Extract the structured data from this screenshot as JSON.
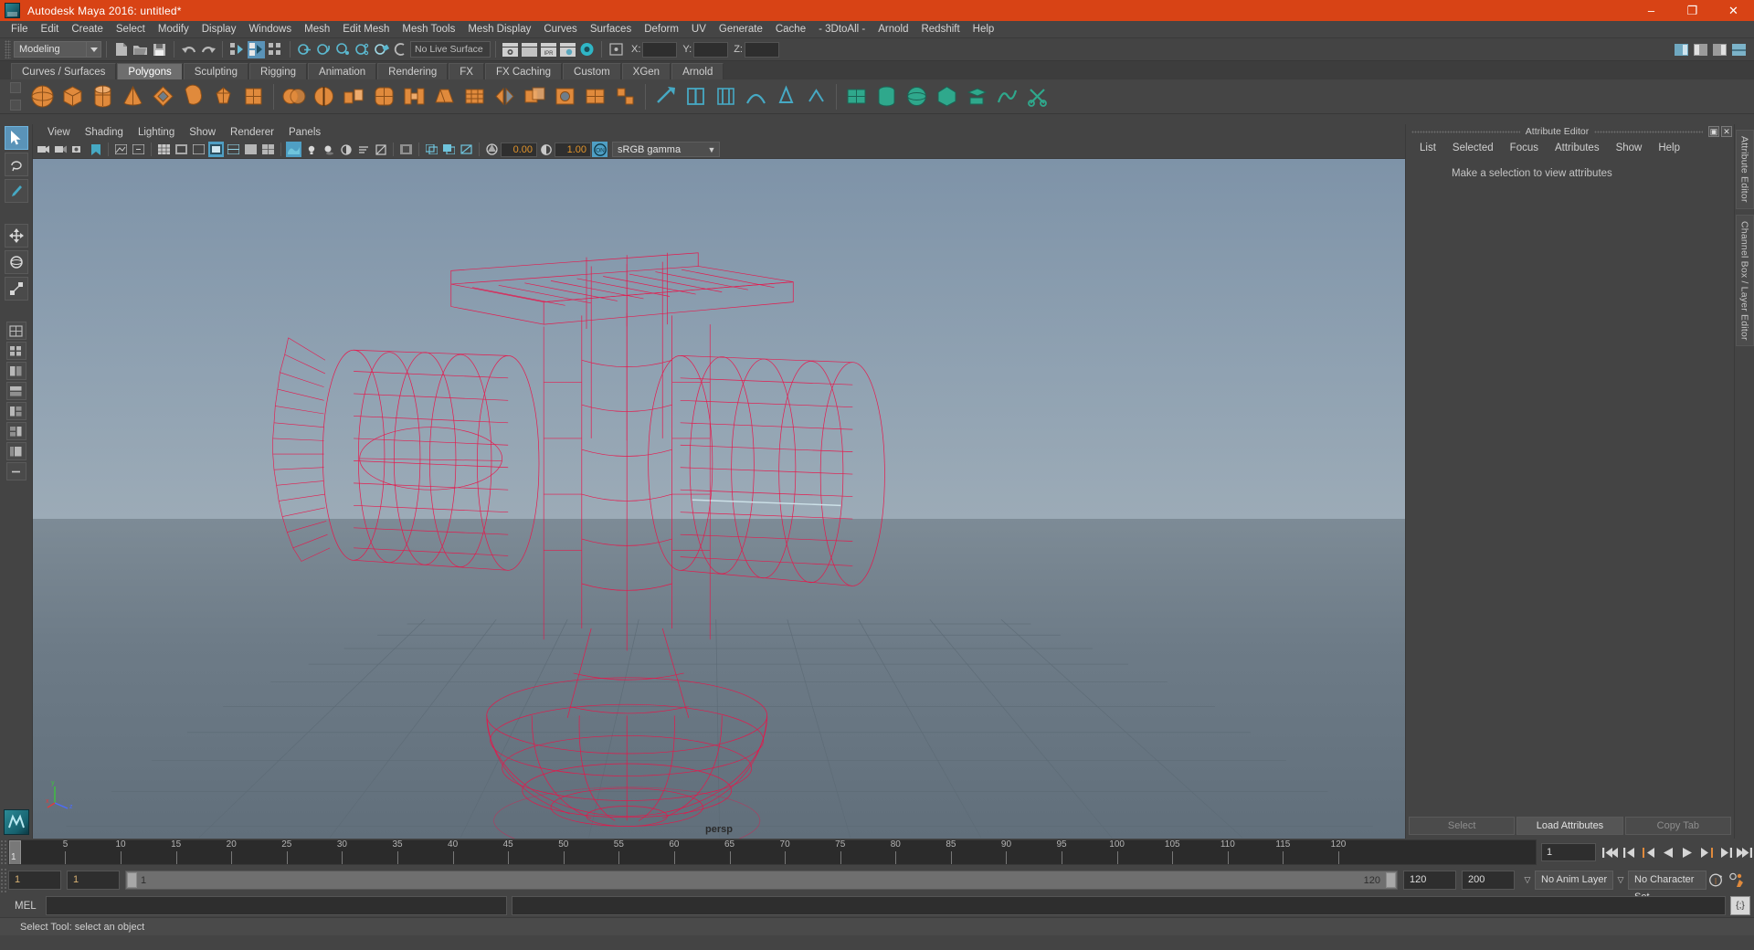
{
  "window": {
    "title": "Autodesk Maya 2016: untitled*",
    "app_icon": "maya-logo-icon",
    "controls": [
      {
        "name": "minimize-button",
        "glyph": "–"
      },
      {
        "name": "maximize-button",
        "glyph": "❐"
      },
      {
        "name": "close-button",
        "glyph": "✕"
      }
    ]
  },
  "menubar": {
    "items": [
      "File",
      "Edit",
      "Create",
      "Select",
      "Modify",
      "Display",
      "Windows",
      "Mesh",
      "Edit Mesh",
      "Mesh Tools",
      "Mesh Display",
      "Curves",
      "Surfaces",
      "Deform",
      "UV",
      "Generate",
      "Cache",
      "- 3DtoAll -",
      "Arnold",
      "Redshift",
      "Help"
    ]
  },
  "statusline": {
    "mode": "Modeling",
    "live_surface": "No Live Surface",
    "coords": [
      {
        "label": "X:",
        "value": ""
      },
      {
        "label": "Y:",
        "value": ""
      },
      {
        "label": "Z:",
        "value": ""
      }
    ],
    "icons": [
      "new-scene-icon",
      "open-scene-icon",
      "save-scene-icon",
      "undo-icon",
      "redo-icon",
      "select-by-hierarchy-icon",
      "select-by-object-icon",
      "select-by-component-icon",
      "snap-to-grid-icon",
      "snap-to-curve-icon",
      "snap-to-point-icon",
      "snap-to-projected-center-icon",
      "snap-to-view-plane-icon",
      "make-live-icon",
      "render-view-icon",
      "render-current-frame-icon",
      "ipr-render-icon",
      "render-settings-icon",
      "hypershade-icon",
      "editor-toggle-icon"
    ],
    "right_icons": [
      "show-attribute-editor-icon",
      "show-tool-settings-icon",
      "show-channel-box-icon",
      "hypershade-panel-icon"
    ]
  },
  "shelf": {
    "tabs": [
      "Curves / Surfaces",
      "Polygons",
      "Sculpting",
      "Rigging",
      "Animation",
      "Rendering",
      "FX",
      "FX Caching",
      "Custom",
      "XGen",
      "Arnold"
    ],
    "active_tab": "Polygons",
    "polygon_primitives": [
      "poly-sphere-icon",
      "poly-cube-icon",
      "poly-cylinder-icon",
      "poly-cone-icon",
      "poly-torus-icon",
      "poly-plane-icon",
      "poly-disc-icon",
      "poly-platonic-icon"
    ],
    "poly_ops": [
      "combine-icon",
      "separate-icon",
      "extrude-icon",
      "bevel-icon",
      "bridge-icon",
      "append-polygon-icon",
      "smooth-icon",
      "mirror-geometry-icon",
      "boolean-icon",
      "fill-hole-icon",
      "reduce-icon",
      "quadrangulate-icon",
      "triangulate-icon",
      "sculpt-geometry-icon",
      "soften-harden-edge-icon",
      "multi-cut-icon",
      "insert-edge-loop-icon",
      "offset-edge-loop-icon",
      "crease-tool-icon"
    ],
    "uv_tools": [
      "uv-planar-icon",
      "uv-cylindrical-icon",
      "uv-spherical-icon",
      "uv-automatic-icon",
      "uv-camera-icon",
      "uv-editor-icon",
      "uv-cut-icon"
    ]
  },
  "toolbox": {
    "tools": [
      {
        "name": "select-tool",
        "icon": "arrow-cursor-icon",
        "selected": true
      },
      {
        "name": "lasso-select-tool",
        "icon": "lasso-icon",
        "selected": false
      },
      {
        "name": "paint-select-tool",
        "icon": "paint-brush-icon",
        "selected": false
      },
      {
        "name": "move-tool",
        "icon": "move-arrows-icon",
        "selected": false
      },
      {
        "name": "rotate-tool",
        "icon": "rotate-circle-icon",
        "selected": false
      },
      {
        "name": "scale-tool",
        "icon": "scale-box-icon",
        "selected": false
      }
    ],
    "layouts": [
      {
        "name": "layout-single-perspective",
        "icon": "single-pane-icon"
      },
      {
        "name": "layout-four-view",
        "icon": "four-pane-icon"
      },
      {
        "name": "layout-two-pane-side",
        "icon": "two-pane-side-icon"
      },
      {
        "name": "layout-two-pane-stacked",
        "icon": "two-pane-stacked-icon"
      },
      {
        "name": "layout-three-pane-left",
        "icon": "three-pane-left-icon"
      },
      {
        "name": "layout-three-pane-right",
        "icon": "three-pane-right-icon"
      },
      {
        "name": "layout-outliner-persp",
        "icon": "outliner-persp-icon"
      },
      {
        "name": "layout-more",
        "icon": "more-layouts-icon"
      }
    ]
  },
  "viewport": {
    "menus": [
      "View",
      "Shading",
      "Lighting",
      "Show",
      "Renderer",
      "Panels"
    ],
    "camera_label": "persp",
    "exposure": "0.00",
    "gamma_value": "1.00",
    "color_profile": "sRGB gamma",
    "gamma_toggle": "ON",
    "axis": {
      "x": "x",
      "y": "y",
      "z": "z"
    },
    "toolbar_icons": [
      "select-camera-icon",
      "lock-camera-icon",
      "camera-attributes-icon",
      "bookmark-icon",
      "image-plane-icon",
      "two-d-pan-zoom-icon",
      "grid-toggle-icon",
      "film-gate-icon",
      "resolution-gate-icon",
      "gate-mask-icon",
      "wireframe-icon",
      "smooth-shade-icon",
      "shaded-wireframe-icon",
      "textured-icon",
      "use-lights-icon",
      "shadows-icon",
      "screen-space-ao-icon",
      "motion-blur-icon",
      "multisample-icon",
      "depth-of-field-icon",
      "isolate-select-icon",
      "xray-icon",
      "xray-joints-icon",
      "exposure-icon",
      "gamma-icon"
    ],
    "model": {
      "name": "electric-fan-wireframe",
      "wireframe_color": "#e8154a",
      "description": "Selected twin-turbine fan model displayed in wireframe"
    }
  },
  "attribute_editor": {
    "title": "Attribute Editor",
    "menus": [
      "List",
      "Selected",
      "Focus",
      "Attributes",
      "Show",
      "Help"
    ],
    "empty_message": "Make a selection to view attributes",
    "footer_buttons": [
      {
        "label": "Select",
        "enabled": false
      },
      {
        "label": "Load Attributes",
        "enabled": true
      },
      {
        "label": "Copy Tab",
        "enabled": false
      }
    ],
    "window_buttons": [
      "undock-icon",
      "close-icon"
    ]
  },
  "side_tabs": [
    "Attribute Editor",
    "Channel Box / Layer Editor"
  ],
  "timeline": {
    "start": 1,
    "end": 120,
    "current_frame": "1",
    "tick_labels": [
      5,
      10,
      15,
      20,
      25,
      30,
      35,
      40,
      45,
      50,
      55,
      60,
      65,
      70,
      75,
      80,
      85,
      90,
      95,
      100,
      105,
      110,
      115,
      120
    ],
    "cursor_label": "1",
    "playback_buttons": [
      "go-to-start-icon",
      "step-back-frame-icon",
      "step-back-key-icon",
      "play-backwards-icon",
      "play-forwards-icon",
      "step-forward-key-icon",
      "step-forward-frame-icon",
      "go-to-end-icon"
    ]
  },
  "range_slider": {
    "anim_start": "1",
    "anim_end": "1",
    "range_start_label": "1",
    "range_end_label": "120",
    "playback_end": "120",
    "anim_end_total": "200",
    "anim_layer": "No Anim Layer",
    "character_set": "No Character Set",
    "icons": [
      "auto-keyframe-icon",
      "animation-preferences-icon"
    ]
  },
  "command_line": {
    "language_label": "MEL",
    "input_value": "",
    "output_value": "",
    "script_editor_icon": "script-editor-icon"
  },
  "helpline": {
    "message": "Select Tool: select an object"
  },
  "colors": {
    "titlebar": "#d84315",
    "chrome": "#444444",
    "accent_blue": "#5a93b8",
    "wireframe_red": "#e8154a",
    "field_orange": "#e0932b",
    "shelf_orange": "#e08a3c"
  }
}
